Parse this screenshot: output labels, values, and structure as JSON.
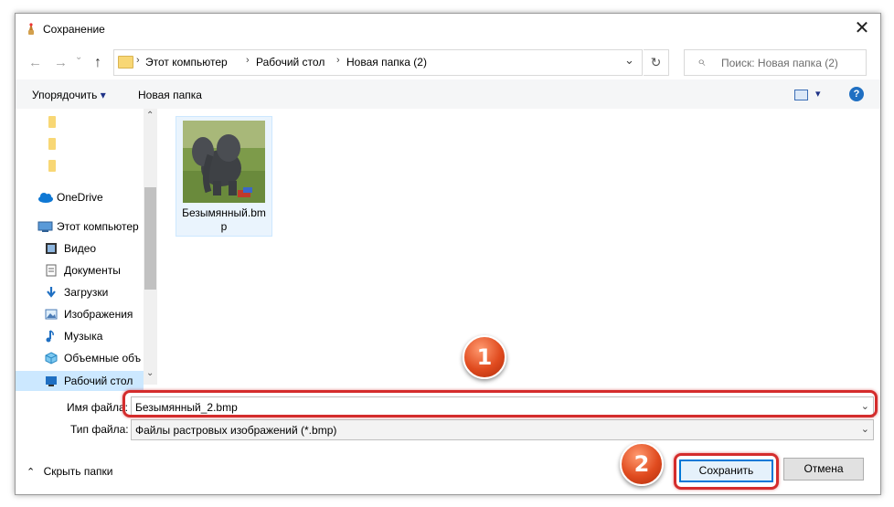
{
  "window": {
    "title": "Сохранение",
    "close_glyph": "✕"
  },
  "nav": {
    "back": "←",
    "forward": "→",
    "up": "↑",
    "chevron": "⌄",
    "refresh": "↻"
  },
  "address": {
    "crumbs": [
      "Этот компьютер",
      "Рабочий стол",
      "Новая папка (2)"
    ],
    "sep": "›",
    "lead_sep": "›"
  },
  "search": {
    "placeholder": "Поиск: Новая папка (2)",
    "icon": "⌕"
  },
  "toolbar": {
    "organize": "Упорядочить",
    "organize_arrow": "▾",
    "new_folder": "Новая папка",
    "view_arrow": "▾",
    "help": "?"
  },
  "sidebar": {
    "items": [
      {
        "label": "OneDrive",
        "icon": "cloud-icon"
      },
      {
        "label": "Этот компьютер",
        "icon": "computer-icon"
      },
      {
        "label": "Видео",
        "icon": "video-icon"
      },
      {
        "label": "Документы",
        "icon": "documents-icon"
      },
      {
        "label": "Загрузки",
        "icon": "downloads-icon"
      },
      {
        "label": "Изображения",
        "icon": "pictures-icon"
      },
      {
        "label": "Музыка",
        "icon": "music-icon"
      },
      {
        "label": "Объемные объ",
        "icon": "3d-objects-icon"
      },
      {
        "label": "Рабочий стол",
        "icon": "desktop-icon"
      }
    ],
    "scroll_up": "⌃",
    "scroll_down": "⌄"
  },
  "files": [
    {
      "name": "Безымянный.bmp"
    }
  ],
  "form": {
    "filename_label": "Имя файла:",
    "filename_value": "Безымянный_2.bmp",
    "filetype_label": "Тип файла:",
    "filetype_value": "Файлы растровых изображений (*.bmp)",
    "dropdown_glyph": "⌄"
  },
  "footer": {
    "hide_folders": "Скрыть папки",
    "hide_arrow": "⌃",
    "save": "Сохранить",
    "cancel": "Отмена"
  },
  "annotations": {
    "badge1": "1",
    "badge2": "2"
  },
  "colors": {
    "accent": "#1e3287",
    "highlight": "#d42c2c",
    "selection": "#cce8ff"
  }
}
